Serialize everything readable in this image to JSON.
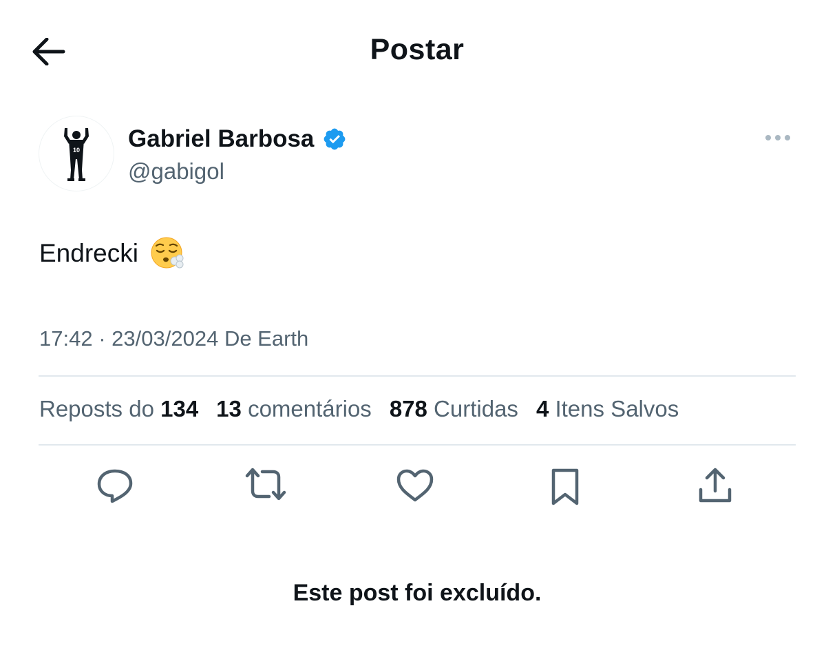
{
  "header": {
    "title": "Postar",
    "back_icon": "arrow-left-icon"
  },
  "author": {
    "name": "Gabriel Barbosa",
    "handle": "@gabigol",
    "verified": true,
    "verified_color": "#1d9bf0",
    "avatar_icon": "player-silhouette-icon",
    "avatar_jersey_number": "10",
    "more_icon": "more-horizontal-icon"
  },
  "post": {
    "text": "Endrecki",
    "emoji": "face-exhaling-emoji",
    "time": "17:42",
    "separator": "·",
    "date": "23/03/2024",
    "source": "De Earth"
  },
  "stats": {
    "reposts_label": "Reposts do",
    "reposts_count": "134",
    "comments_count": "13",
    "comments_label": "comentários",
    "likes_count": "878",
    "likes_label": "Curtidas",
    "saves_count": "4",
    "saves_label": "Itens Salvos"
  },
  "actions": [
    {
      "icon": "reply-icon"
    },
    {
      "icon": "repost-icon"
    },
    {
      "icon": "like-icon"
    },
    {
      "icon": "bookmark-icon"
    },
    {
      "icon": "share-icon"
    }
  ],
  "footer": {
    "deleted_note": "Este post foi excluído."
  },
  "colors": {
    "text_primary": "#0f1419",
    "text_secondary": "#536471",
    "divider": "#e1e8ed",
    "verified": "#1d9bf0",
    "icon": "#536471"
  }
}
